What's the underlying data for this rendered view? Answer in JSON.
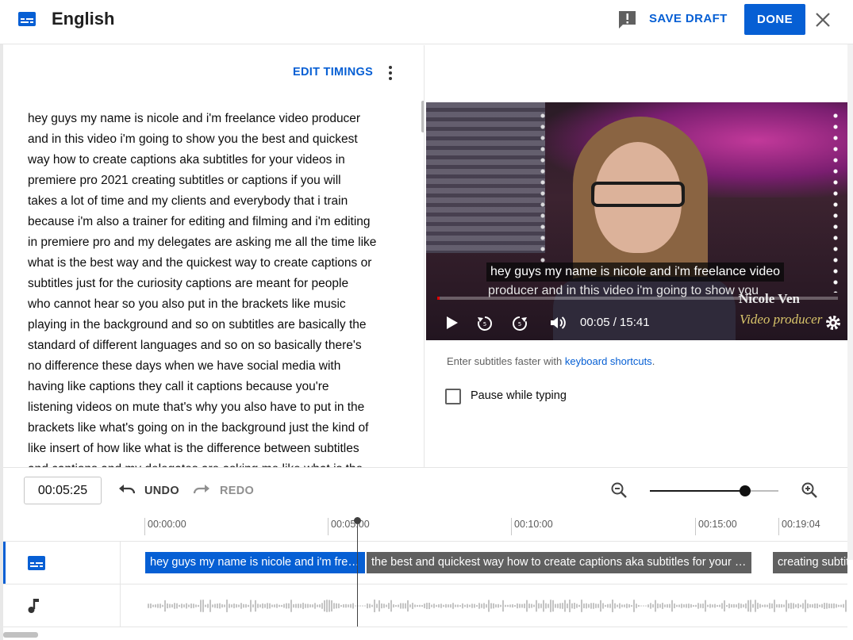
{
  "header": {
    "language": "English",
    "save_draft": "SAVE DRAFT",
    "done": "DONE",
    "icons": [
      "subtitles-icon",
      "feedback-icon",
      "close-icon"
    ]
  },
  "editor": {
    "edit_timings": "EDIT TIMINGS",
    "transcript": "hey guys my name is nicole and i'm freelance video producer\nand in this video i'm going to show you the best and quickest\nway how to create captions aka subtitles for your videos in\npremiere pro 2021 creating subtitles or captions if you will\ntakes a lot of time and my clients and everybody that i train\nbecause i'm also a trainer for editing and filming and i'm editing\nin premiere pro and my delegates are asking me all the time like\nwhat is the best way and the quickest way to create captions or\nsubtitles just for the curiosity captions are meant for people\nwho cannot hear so you also put in the brackets like music\nplaying in the background and so on subtitles are basically the\nstandard of different languages and so on so basically there's\nno difference these days when we have social media with\nhaving like captions they call it captions because you're\nlistening videos on mute that's why you also have to put in the\nbrackets like what's going on in the background just the kind of\nlike insert of how like what is the difference between subtitles\nand captions and my delegates are asking me like what is the"
  },
  "video": {
    "caption_line1": "hey guys my name is nicole and i'm freelance video",
    "caption_line2": "producer and in this video i'm going to show you",
    "time": "00:05 / 15:41",
    "progress": 0.0053,
    "logo_name": "Nicole Ven",
    "logo_tagline": "Video producer",
    "controls": [
      "play-icon",
      "rewind-icon",
      "forward-icon",
      "volume-icon",
      "settings-icon"
    ]
  },
  "hint": {
    "text": "Enter subtitles faster with ",
    "link": "keyboard shortcuts",
    "end": "."
  },
  "pause_while_typing": {
    "label": "Pause while typing",
    "checked": false
  },
  "toolbar": {
    "current_time": "00:05:25",
    "undo": "UNDO",
    "redo": "REDO",
    "zoom_level": 0.74
  },
  "timeline": {
    "ticks": [
      "00:00:00",
      "00:05:00",
      "00:10:00",
      "00:15:00",
      "00:19:04"
    ],
    "cues": [
      {
        "text": "hey guys my name is nicole and i'm freelance video producer",
        "state": "active"
      },
      {
        "text": "the best and quickest way how to create captions  aka subtitles for your videos",
        "state": "idle"
      },
      {
        "text": "creating subtitles or captions",
        "state": "idle"
      }
    ]
  },
  "colors": {
    "accent": "#065fd4",
    "cue_idle": "#606060",
    "progress": "#dd0000"
  }
}
